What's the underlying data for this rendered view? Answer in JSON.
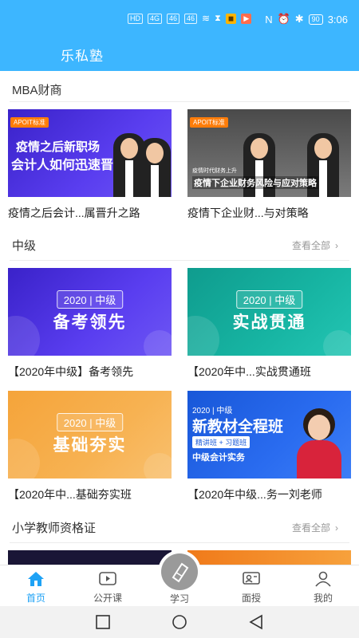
{
  "status_bar": {
    "left_chips": [
      "HD",
      "4G",
      "46",
      "46"
    ],
    "time": "3:06",
    "battery": "90"
  },
  "app_title": "乐私塾",
  "sections": [
    {
      "title": "MBA财商",
      "view_all": "",
      "cards": [
        {
          "title": "疫情之后会计...属晋升之路",
          "tag": "APOIT标准",
          "line1": "疫情之后新职场",
          "line2": "会计人如何迅速晋升?"
        },
        {
          "title": "疫情下企业财...与对策略",
          "tag": "APOIT标准",
          "line1": "疫情时代财务上升",
          "line2": "疫情下企业财务风险与应对策略"
        }
      ]
    },
    {
      "title": "中级",
      "view_all": "查看全部",
      "cards": [
        {
          "title": "【2020年中级】备考领先",
          "year": "2020 | 中级",
          "big": "备考领先"
        },
        {
          "title": "【2020年中...实战贯通班",
          "year": "2020 | 中级",
          "big": "实战贯通"
        },
        {
          "title": "【2020年中...基础夯实班",
          "year": "2020 | 中级",
          "big": "基础夯实"
        },
        {
          "title": "【2020年中级...务一刘老师",
          "year": "2020 | 中级",
          "big": "新教材全程班",
          "sub": "精讲班 + 习题班",
          "sub2": "中级会计实务"
        }
      ]
    },
    {
      "title": "小学教师资格证",
      "view_all": "查看全部"
    }
  ],
  "tabbar": [
    {
      "label": "首页",
      "active": true
    },
    {
      "label": "公开课",
      "active": false
    },
    {
      "label": "学习",
      "active": false
    },
    {
      "label": "面授",
      "active": false
    },
    {
      "label": "我的",
      "active": false
    }
  ],
  "colors": {
    "primary": "#3db6ff",
    "active_tab": "#1ea2f5"
  }
}
